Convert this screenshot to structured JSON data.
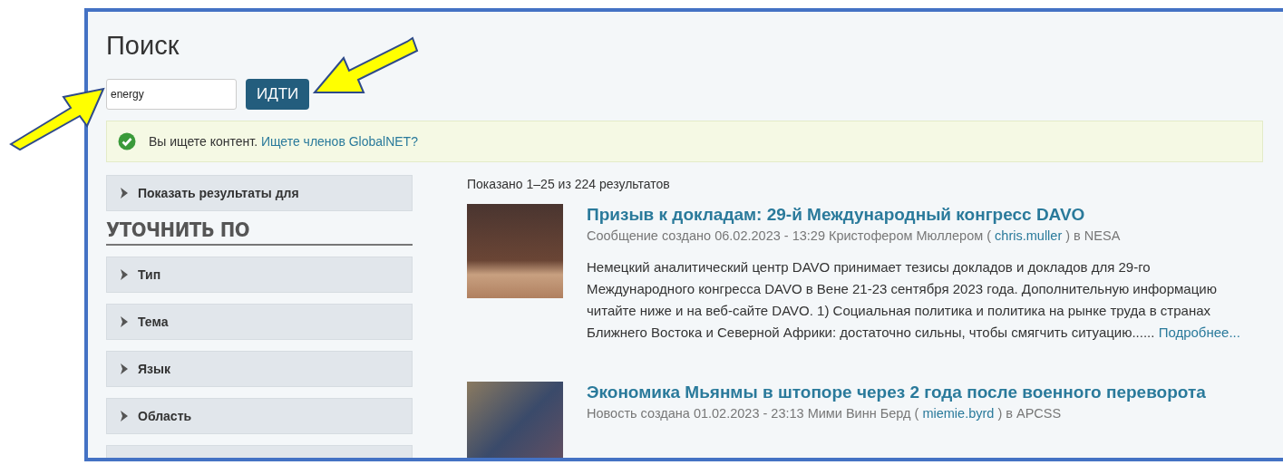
{
  "page_title": "Поиск",
  "search": {
    "value": "energy",
    "button": "ИДТИ"
  },
  "notice": {
    "text": "Вы ищете контент.",
    "link": "Ищете членов GlobalNET?"
  },
  "sidebar": {
    "show_results": "Показать результаты для",
    "refine_heading": "УТОЧНИТЬ ПО",
    "facets": [
      {
        "label": "Тип",
        "expanded": false
      },
      {
        "label": "Тема",
        "expanded": false
      },
      {
        "label": "Язык",
        "expanded": false
      },
      {
        "label": "Область",
        "expanded": false
      }
    ]
  },
  "results_count": "Показано 1–25 из 224 результатов",
  "results": [
    {
      "title": "Призыв к докладам: 29-й Международный конгресс DAVO",
      "meta_prefix": "Сообщение создано 06.02.2023 - 13:29 Кристофером Мюллером (",
      "author": "chris.muller",
      "meta_suffix": ") в NESA",
      "summary": "Немецкий аналитический центр DAVO принимает тезисы докладов и докладов для 29-го Международного конгресса DAVO в Вене 21-23 сентября 2023 года. Дополнительную информацию читайте ниже и на веб-сайте DAVO. 1) Социальная политика и политика на рынке труда в странах Ближнего Востока и Северной Африки: достаточно сильны, чтобы смягчить ситуацию......",
      "more": "Подробнее..."
    },
    {
      "title": "Экономика Мьянмы в штопоре через 2 года после военного переворота",
      "meta_prefix": "Новость создана 01.02.2023 - 23:13 Мими Винн Берд (",
      "author": "miemie.byrd",
      "meta_suffix": ") в APCSS"
    }
  ]
}
